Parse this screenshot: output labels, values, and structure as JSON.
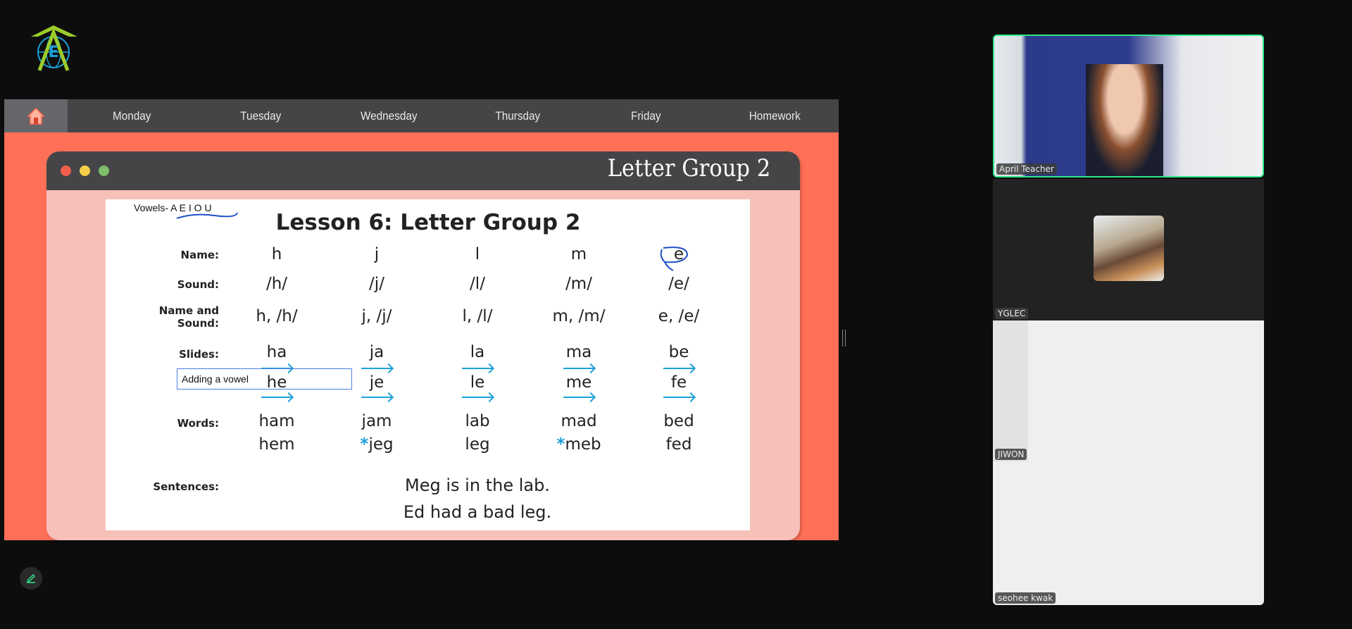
{
  "logo": {
    "letter": "E"
  },
  "nav": {
    "home_icon": "home-icon",
    "tabs": [
      "Monday",
      "Tuesday",
      "Wednesday",
      "Thursday",
      "Friday",
      "Homework"
    ]
  },
  "window": {
    "title": "Letter Group 2",
    "dots": [
      "#f25f4c",
      "#f7d04a",
      "#7fbf6a"
    ]
  },
  "lesson": {
    "title": "Lesson 6: Letter Group 2",
    "vowels_note": "Vowels- A E I O U",
    "labels": {
      "name": "Name:",
      "sound": "Sound:",
      "name_sound_1": "Name and",
      "name_sound_2": "Sound:",
      "slides": "Slides:",
      "words": "Words:",
      "sentences": "Sentences:"
    },
    "names": [
      "h",
      "j",
      "l",
      "m",
      "e"
    ],
    "sounds": [
      "/h/",
      "/j/",
      "/l/",
      "/m/",
      "/e/"
    ],
    "name_sound": [
      "h, /h/",
      "j, /j/",
      "l, /l/",
      "m, /m/",
      "e, /e/"
    ],
    "slides1": [
      "ha",
      "ja",
      "la",
      "ma",
      "be"
    ],
    "slides2": [
      "he",
      "je",
      "le",
      "me",
      "fe"
    ],
    "words1": [
      "ham",
      "jam",
      "lab",
      "mad",
      "bed"
    ],
    "words2": [
      "hem",
      "jeg",
      "leg",
      "meb",
      "fed"
    ],
    "starred_words": [
      1,
      3
    ],
    "star": "*",
    "sentences": [
      "Meg is in the lab.",
      "Ed had a bad leg."
    ],
    "annotation": "Adding a vowel"
  },
  "participants": [
    {
      "name": "April Teacher",
      "active": true
    },
    {
      "name": "YGLEC"
    },
    {
      "name": "JIWON"
    },
    {
      "name": "seohee kwak"
    }
  ],
  "colors": {
    "accent_border": "#2ee88a",
    "stage": "#ff7056",
    "annotation": "#1e4fc8",
    "arrow": "#1ea0d8"
  }
}
